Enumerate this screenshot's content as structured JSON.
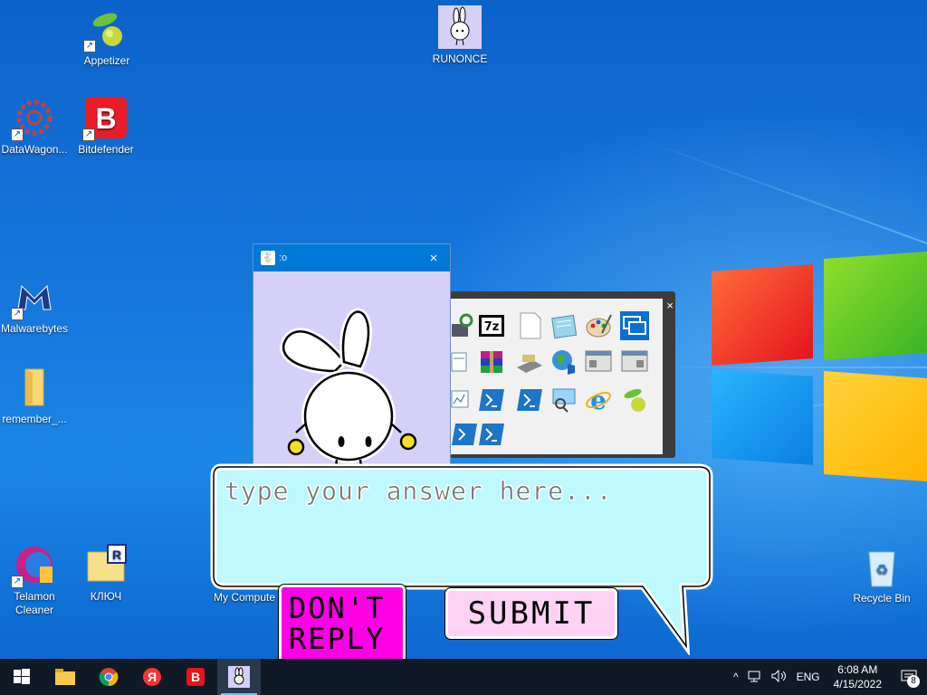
{
  "desktop": {
    "icons": [
      {
        "label": "Appetizer",
        "icon": "appetizer-icon"
      },
      {
        "label": "RUNONCE",
        "icon": "rabbit-icon"
      },
      {
        "label": "DataWagon...",
        "icon": "datawagon-icon"
      },
      {
        "label": "Bitdefender",
        "icon": "bitdefender-icon"
      },
      {
        "label": "Malwarebytes",
        "icon": "malwarebytes-icon"
      },
      {
        "label": "remember_...",
        "icon": "folder-icon"
      },
      {
        "label": "Telamon Cleaner",
        "icon": "telamon-icon"
      },
      {
        "label": "КЛЮЧ",
        "icon": "key-folder-icon"
      },
      {
        "label": "My Compute",
        "icon": "computer-icon"
      },
      {
        "label": "Recycle Bin",
        "icon": "recycle-bin-icon"
      }
    ]
  },
  "rabbit_window": {
    "title": ":o",
    "close_glyph": "×"
  },
  "icon_panel": {
    "close_glyph": "×",
    "sevenzip_label": "7z"
  },
  "dialog": {
    "answer_placeholder": "type your answer here...",
    "dont_reply_label": "DON'T REPLY",
    "submit_label": "SUBMIT"
  },
  "taskbar": {
    "pinned": [
      "windows-start",
      "file-explorer",
      "chrome",
      "yandex",
      "vivaldi",
      "runonce-rabbit"
    ],
    "yandex_glyph": "Я",
    "vivaldi_glyph": "B",
    "tray": {
      "chevron": "^",
      "language": "ENG",
      "time": "6:08 AM",
      "date": "4/15/2022",
      "notification_count": "8"
    }
  },
  "colors": {
    "taskbar": "#101a26",
    "titlebar": "#0078d7",
    "bubble": "#bff8ff",
    "dont_reply": "#ff00e6",
    "submit": "#ffd2f5",
    "rabbit_bg": "#d4d0f8"
  }
}
